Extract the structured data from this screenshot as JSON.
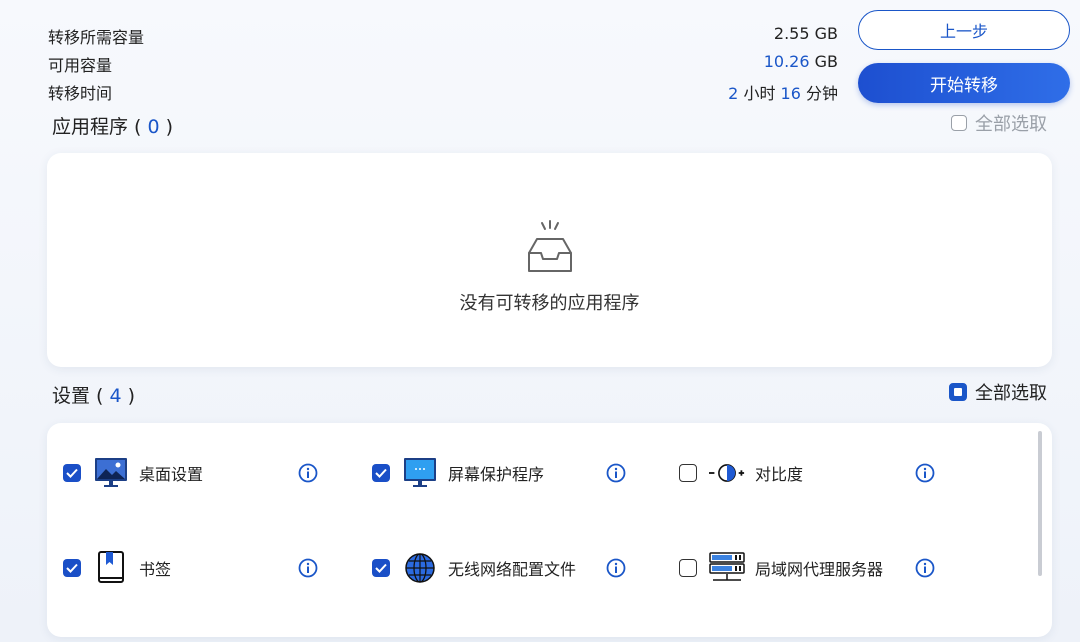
{
  "summary": {
    "required_label": "转移所需容量",
    "required_value": "2.55 GB",
    "available_label": "可用容量",
    "available_number": "10.26",
    "available_unit": " GB",
    "time_label": "转移时间",
    "time_hours": "2",
    "time_hours_unit": " 小时 ",
    "time_minutes": "16",
    "time_minutes_unit": " 分钟"
  },
  "buttons": {
    "prev_label": "上一步",
    "start_label": "开始转移"
  },
  "apps": {
    "title_prefix": "应用程序 ( ",
    "count": "0",
    "title_suffix": " )",
    "select_all_label": "全部选取",
    "empty_text": "没有可转移的应用程序"
  },
  "settings": {
    "title_prefix": "设置 ( ",
    "count": "4",
    "title_suffix": " )",
    "select_all_label": "全部选取",
    "items": [
      {
        "label": "桌面设置",
        "checked": true,
        "icon": "desktop-icon"
      },
      {
        "label": "屏幕保护程序",
        "checked": true,
        "icon": "screensaver-icon"
      },
      {
        "label": "对比度",
        "checked": false,
        "icon": "contrast-icon"
      },
      {
        "label": "书签",
        "checked": true,
        "icon": "bookmark-icon"
      },
      {
        "label": "无线网络配置文件",
        "checked": true,
        "icon": "globe-icon"
      },
      {
        "label": "局域网代理服务器",
        "checked": false,
        "icon": "server-icon"
      }
    ]
  },
  "colors": {
    "accent": "#1a56c8",
    "background": "#f3f6fb",
    "card": "#ffffff"
  }
}
